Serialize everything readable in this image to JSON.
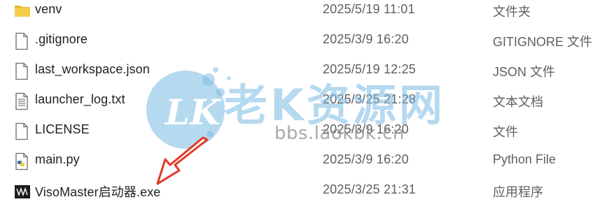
{
  "files": [
    {
      "name": "venv",
      "date": "2025/5/19 11:01",
      "type": "文件夹",
      "icon": "folder-icon"
    },
    {
      "name": ".gitignore",
      "date": "2025/3/9 16:20",
      "type": "GITIGNORE 文件",
      "icon": "file-icon"
    },
    {
      "name": "last_workspace.json",
      "date": "2025/5/19 12:25",
      "type": "JSON 文件",
      "icon": "file-icon"
    },
    {
      "name": "launcher_log.txt",
      "date": "2025/3/25 21:28",
      "type": "文本文档",
      "icon": "text-file-icon"
    },
    {
      "name": "LICENSE",
      "date": "2025/3/9 16:20",
      "type": "文件",
      "icon": "file-icon"
    },
    {
      "name": "main.py",
      "date": "2025/3/9 16:20",
      "type": "Python File",
      "icon": "python-file-icon"
    },
    {
      "name": "VisoMaster启动器.exe",
      "date": "2025/3/25 21:31",
      "type": "应用程序",
      "icon": "app-icon"
    }
  ],
  "watermark": {
    "logo_text": "LK",
    "title": "老K资源网",
    "url": "bbs.laokbk.cn"
  },
  "colors": {
    "folder": "#f4c542",
    "watermark_blue": "#7ab9e1",
    "arrow_red": "#e03a2a"
  }
}
